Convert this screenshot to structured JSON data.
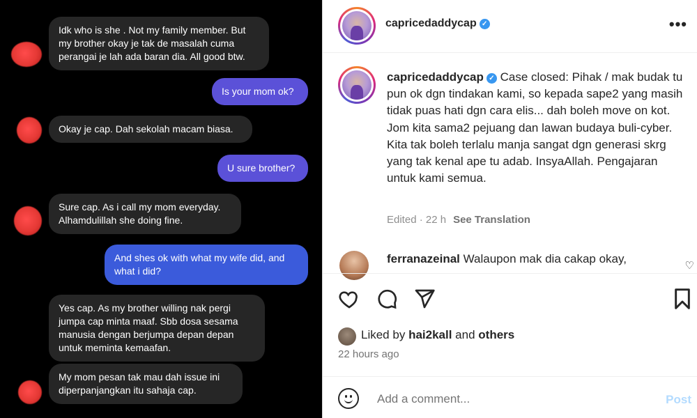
{
  "chat": {
    "messages": [
      {
        "dir": "in",
        "text": "Idk who is she . Not my family member. But my brother okay je tak de masalah cuma perangai je lah ada baran dia. All good btw."
      },
      {
        "dir": "out",
        "text": "Is your mom ok?"
      },
      {
        "dir": "in",
        "text": "Okay je cap. Dah sekolah macam biasa."
      },
      {
        "dir": "out",
        "text": "U sure brother?"
      },
      {
        "dir": "in",
        "text": "Sure cap. As i call my mom everyday. Alhamdulillah she doing fine."
      },
      {
        "dir": "out",
        "text": "And shes ok with what my wife did, and what i did?"
      },
      {
        "dir": "in",
        "text": "Yes cap. As my brother willing nak pergi jumpa cap minta maaf. Sbb dosa sesama manusia dengan berjumpa depan depan untuk meminta kemaafan."
      },
      {
        "dir": "in",
        "text": "My mom pesan tak mau dah issue ini diperpanjangkan itu sahaja cap."
      }
    ]
  },
  "post": {
    "header_username": "capricedaddycap",
    "more_icon": "more-horizontal-icon",
    "caption_username": "capricedaddycap",
    "caption_text": "Case closed: Pihak / mak budak tu pun ok dgn tindakan kami, so kepada sape2 yang masih tidak puas hati dgn cara elis... dah boleh move on kot. Jom kita sama2 pejuang dan lawan budaya buli-cyber. Kita tak boleh terlalu manja sangat dgn generasi skrg yang tak kenal ape tu adab. InsyaAllah. Pengajaran untuk kami semua.",
    "edited_meta": "Edited · 22 h",
    "see_translation": "See Translation",
    "comment_username": "ferranazeinal",
    "comment_text": "Walaupon mak dia cakap okay,",
    "likes_prefix": "Liked by",
    "likes_user": "hai2kall",
    "likes_and": "and",
    "likes_others": "others",
    "time_ago": "22 hours ago",
    "add_comment_placeholder": "Add a comment...",
    "post_label": "Post"
  },
  "colors": {
    "outgoing_bubble": "#5b51d8",
    "outgoing_bubble_blue": "#3b5bdb",
    "incoming_bubble": "#262626",
    "verified": "#3897f0",
    "post_button_disabled": "#b3dbff"
  }
}
